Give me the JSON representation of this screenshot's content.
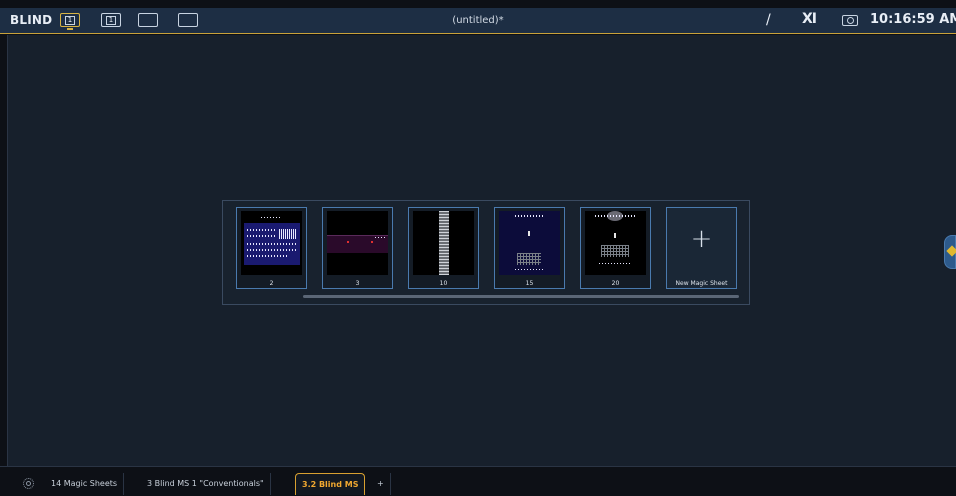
{
  "topbar": {
    "mode": "BLIND",
    "displays": [
      "1",
      "1",
      "",
      ""
    ],
    "title": "(untitled)*",
    "clock": "10:16:59 AM",
    "icons": [
      "magic-wand-icon",
      "tool-icon",
      "camera-icon"
    ]
  },
  "magic_sheet_picker": {
    "sheets": [
      {
        "label": "2"
      },
      {
        "label": "3"
      },
      {
        "label": "10"
      },
      {
        "label": "15"
      },
      {
        "label": "20"
      }
    ],
    "new_label": "New Magic Sheet",
    "new_icon": "plus-icon"
  },
  "tabs": {
    "settings_icon": "gear-icon",
    "items": [
      {
        "label": "14 Magic Sheets"
      },
      {
        "label": "3 Blind MS 1 \"Conventionals\""
      },
      {
        "label": "3.2 Blind MS"
      },
      {
        "label": "+"
      }
    ],
    "active_index": 2
  },
  "colors": {
    "accent": "#d8a030",
    "topbar_bg": "#1d2e44",
    "main_bg": "#17202c",
    "card_border": "#4a7aae"
  }
}
